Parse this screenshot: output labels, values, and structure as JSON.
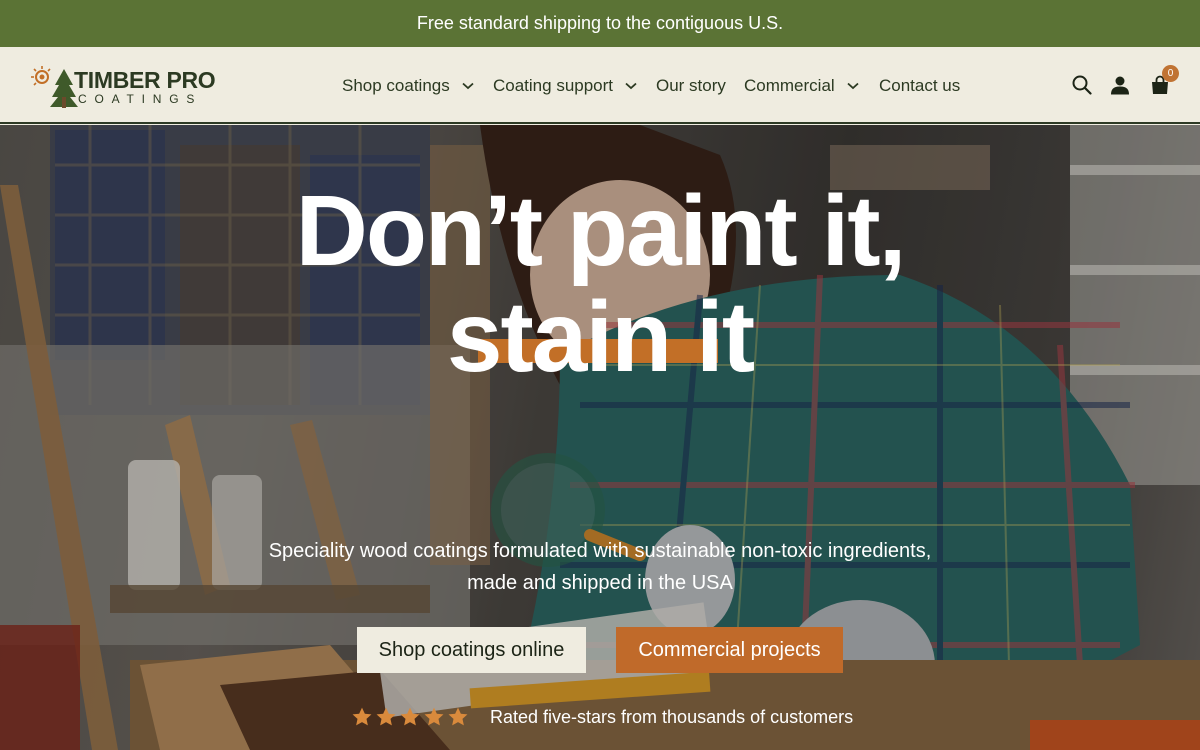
{
  "announcement": "Free standard shipping to the contiguous U.S.",
  "logo": {
    "line1": "TIMBER PRO",
    "line2": "COATINGS"
  },
  "nav": {
    "shop_coatings": "Shop coatings",
    "coating_support": "Coating support",
    "our_story": "Our story",
    "commercial": "Commercial",
    "contact_us": "Contact us"
  },
  "header_icons": {
    "search": "search-icon",
    "account": "user-icon",
    "cart": "shopping-bag-icon"
  },
  "cart_count": "0",
  "hero": {
    "headline_line1": "Don’t paint it,",
    "headline_line2": "stain it",
    "subtitle_line1": "Speciality wood coatings formulated with sustainable non-toxic ingredients,",
    "subtitle_line2": "made and shipped in the USA",
    "primary_button": "Shop coatings online",
    "secondary_button": "Commercial projects",
    "rating_stars": 5,
    "rating_text": "Rated five-stars from thousands of customers"
  },
  "colors": {
    "announcement_bg": "#5b7335",
    "header_bg": "#efece0",
    "accent_orange": "#c06a2a",
    "text_dark": "#2c3a22"
  }
}
